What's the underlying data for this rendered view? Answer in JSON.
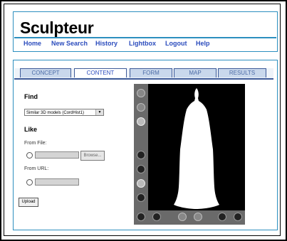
{
  "app": {
    "logo": "Sculpteur"
  },
  "nav": {
    "items": [
      "Home",
      "New Search",
      "History",
      "Lightbox",
      "Logout",
      "Help"
    ]
  },
  "tabs": [
    {
      "label": "CONCEPT",
      "active": false
    },
    {
      "label": "CONTENT",
      "active": true
    },
    {
      "label": "FORM",
      "active": false
    },
    {
      "label": "MAP",
      "active": false
    },
    {
      "label": "RESULTS",
      "active": false
    }
  ],
  "find": {
    "heading": "Find",
    "select_value": "Similar 3D models (CordHist1)"
  },
  "like": {
    "heading": "Like",
    "from_file_label": "From File:",
    "browse_label": "Browse...",
    "from_url_label": "From URL:"
  },
  "upload_label": "Upload",
  "colors": {
    "accent": "#2c8fbf",
    "nav_text": "#2b4cbd",
    "tab_bg": "#c9d8ec",
    "viewer_bg": "#000000"
  },
  "viewer": {
    "vertical_tools": [
      "rotate-icon",
      "rotate-icon",
      "light-icon",
      "spin-icon",
      "move-icon",
      "light-icon",
      "zoom-icon",
      "rotate-icon"
    ],
    "horizontal_tools": [
      "rotate-left-icon",
      "rotate-right-icon",
      "prev-icon",
      "next-icon",
      "spin-left-icon",
      "spin-right-icon"
    ]
  }
}
